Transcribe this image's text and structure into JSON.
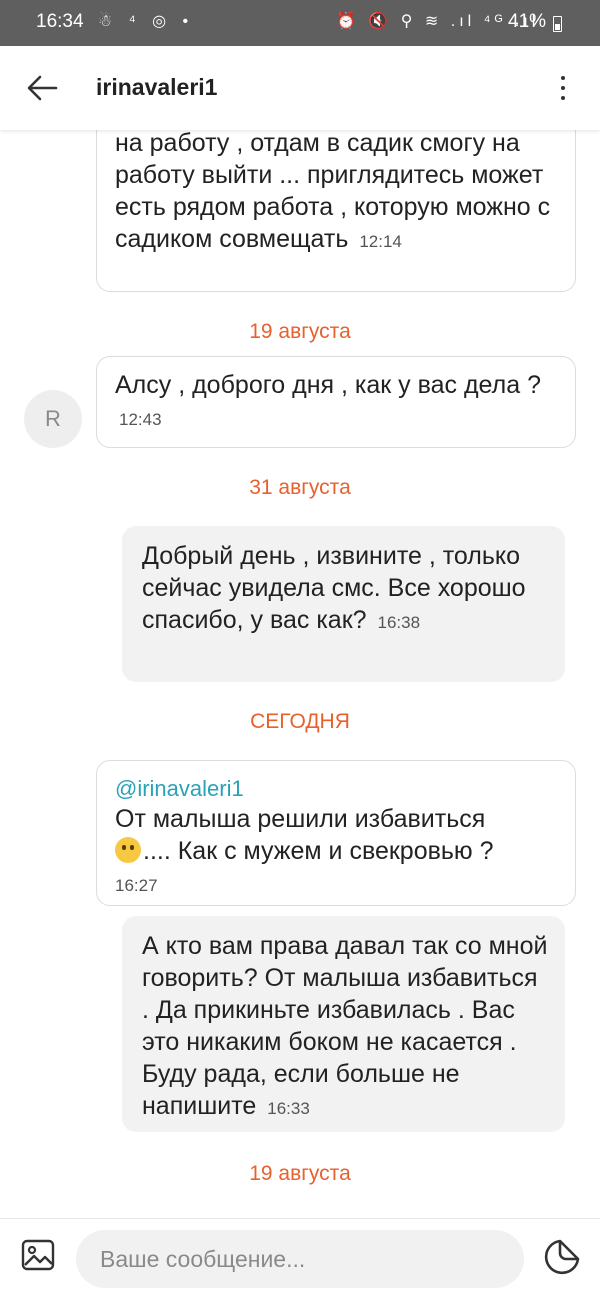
{
  "status_bar": {
    "time": "16:34",
    "left_icons": "☃ ⁴ ◎ •",
    "right_icons": "⏰ 🔇 ⚲ ≋ .ıl ⁴ᴳ .ıl",
    "battery": "41%"
  },
  "header": {
    "title": "irinavaleri1"
  },
  "avatar_initial": "R",
  "messages": [
    {
      "side": "in",
      "text": "на работу , отдам в садик смогу на работу выйти ... приглядитесь может есть рядом работа , которую можно с садиком совмещать",
      "time": "12:14"
    },
    {
      "type": "date",
      "text": "19 августа"
    },
    {
      "side": "in",
      "text": "Алсу , доброго дня , как у вас дела ?",
      "time": "12:43"
    },
    {
      "type": "date",
      "text": "31 августа"
    },
    {
      "side": "out",
      "text": "Добрый день , извините , только сейчас увидела смс. Все хорошо спасибо,  у вас как?",
      "time": "16:38"
    },
    {
      "type": "date",
      "text": "СЕГОДНЯ"
    },
    {
      "side": "in",
      "reply_to": "@irinavaleri1",
      "text_line1": "От малыша решили избавиться",
      "emoji": "slightly-smiling-face",
      "text_line2": ".... Как с мужем и свекровью ?",
      "time": "16:27"
    },
    {
      "side": "out",
      "text": "А кто вам права давал так со мной говорить? От малыша избавиться . Да прикиньте избавилась . Вас это никаким боком не касается . Буду рада, если  больше не напишите",
      "time": "16:33"
    },
    {
      "type": "date",
      "text": "19 августа"
    }
  ],
  "composer": {
    "placeholder": "Ваше сообщение..."
  },
  "colors": {
    "accent_date": "#e8602c",
    "mention": "#2aa3b8",
    "status_bar": "#5f5f5f"
  }
}
